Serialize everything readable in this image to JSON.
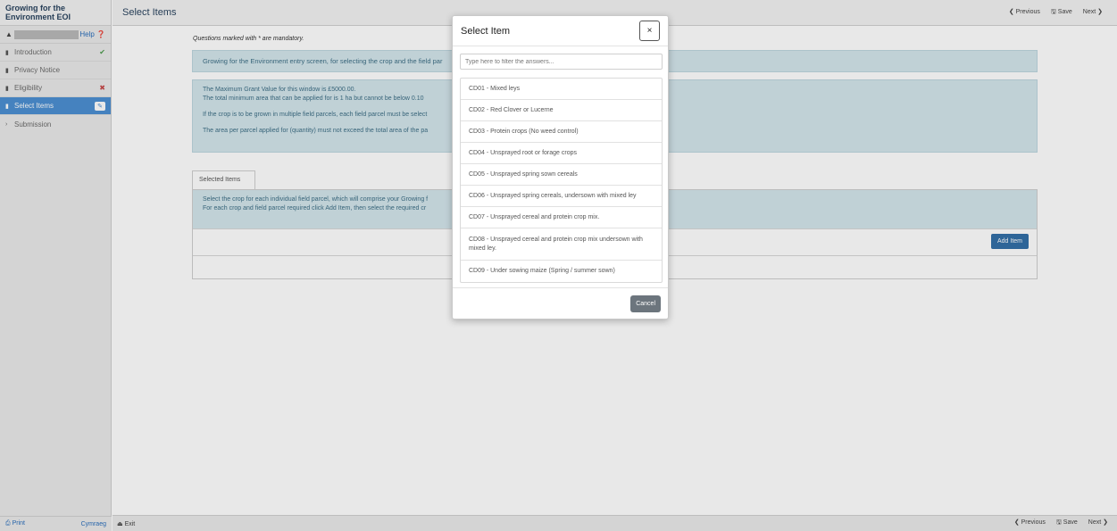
{
  "sidebar": {
    "title": "Growing for the Environment EOI",
    "help_label": "Help",
    "items": [
      {
        "label": "Introduction",
        "status": "✔"
      },
      {
        "label": "Privacy Notice",
        "status": ""
      },
      {
        "label": "Eligibility",
        "status": "✖"
      },
      {
        "label": "Select Items",
        "status": "✎"
      },
      {
        "label": "Submission",
        "status": ""
      }
    ],
    "print_label": "Print",
    "language_label": "Cymraeg"
  },
  "header": {
    "page_title": "Select Items",
    "previous_label": "Previous",
    "save_label": "Save",
    "next_label": "Next"
  },
  "main": {
    "mandatory_note": "Questions marked with * are mandatory.",
    "intro_text": "Growing for the Environment entry screen, for selecting the crop and the field par",
    "info_lines": [
      "The Maximum Grant Value for this window is £5000.00.",
      "The total minimum area that can be applied for is 1 ha but cannot be below 0.10",
      "If the crop is to be grown in multiple field parcels, each field parcel must be select",
      "The area per parcel applied for (quantity) must not exceed the total area of the pa"
    ],
    "tab_label": "Selected Items",
    "panel_lines": [
      "Select the crop for each individual field parcel, which will comprise your Growing f",
      "For each crop and field parcel required click Add Item, then select the required cr"
    ],
    "add_item_label": "Add Item"
  },
  "footer": {
    "exit_label": "Exit"
  },
  "modal": {
    "title": "Select Item",
    "close_label": "×",
    "filter_placeholder": "Type here to filter the answers...",
    "items": [
      "CD01 - Mixed leys",
      "CD02 - Red Clover or Lucerne",
      "CD03 - Protein crops (No weed control)",
      "CD04 - Unsprayed root or forage crops",
      "CD05 - Unsprayed spring sown cereals",
      "CD06 - Unsprayed spring cereals, undersown with mixed ley",
      "CD07 - Unsprayed cereal and protein crop mix.",
      "CD08 - Unsprayed cereal and protein crop mix undersown with mixed ley.",
      "CD09 - Under sowing maize (Spring / summer sown)"
    ],
    "cancel_label": "Cancel"
  }
}
